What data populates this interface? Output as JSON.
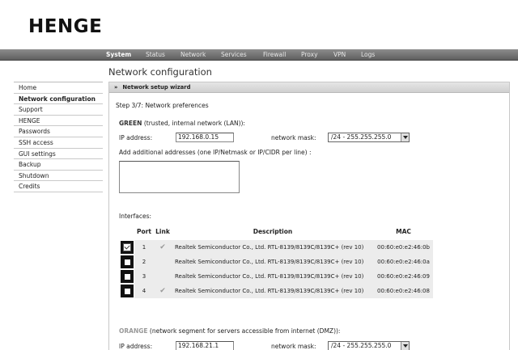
{
  "logo": {
    "text": "HENGE"
  },
  "topnav": {
    "items": [
      "System",
      "Status",
      "Network",
      "Services",
      "Firewall",
      "Proxy",
      "VPN",
      "Logs"
    ],
    "active": "System"
  },
  "page_title": "Network configuration",
  "sidebar": {
    "items": [
      "Home",
      "Network configuration",
      "Support",
      "HENGE",
      "Passwords",
      "SSH access",
      "GUI settings",
      "Backup",
      "Shutdown",
      "Credits"
    ],
    "active": "Network configuration"
  },
  "panel": {
    "header_arrows": "»",
    "header_title": "Network setup wizard",
    "step": "Step 3/7: Network preferences",
    "green": {
      "name": "GREEN",
      "description": "(trusted, internal network (LAN)):",
      "ip_label": "IP address:",
      "ip_value": "192.168.0.15",
      "mask_label": "network mask:",
      "mask_value": "/24 - 255.255.255.0",
      "additional_label": "Add additional addresses (one IP/Netmask or IP/CIDR per line) :"
    },
    "interfaces": {
      "label": "Interfaces:",
      "columns": {
        "port": "Port",
        "link": "Link",
        "description": "Description",
        "mac": "MAC"
      },
      "rows": [
        {
          "checked": true,
          "port": "1",
          "link": true,
          "description": "Realtek Semiconductor Co., Ltd. RTL-8139/8139C/8139C+ (rev 10)",
          "mac": "00:60:e0:e2:46:0b"
        },
        {
          "checked": false,
          "port": "2",
          "link": false,
          "description": "Realtek Semiconductor Co., Ltd. RTL-8139/8139C/8139C+ (rev 10)",
          "mac": "00:60:e0:e2:46:0a"
        },
        {
          "checked": false,
          "port": "3",
          "link": false,
          "description": "Realtek Semiconductor Co., Ltd. RTL-8139/8139C/8139C+ (rev 10)",
          "mac": "00:60:e0:e2:46:09"
        },
        {
          "checked": false,
          "port": "4",
          "link": true,
          "description": "Realtek Semiconductor Co., Ltd. RTL-8139/8139C/8139C+ (rev 10)",
          "mac": "00:60:e0:e2:46:08"
        }
      ]
    },
    "orange": {
      "name": "ORANGE",
      "description": "(network segment for servers accessible from internet (DMZ)):",
      "ip_label": "IP address:",
      "ip_value": "192.168.21.1",
      "mask_label": "network mask:",
      "mask_value": "/24 - 255.255.255.0"
    }
  }
}
